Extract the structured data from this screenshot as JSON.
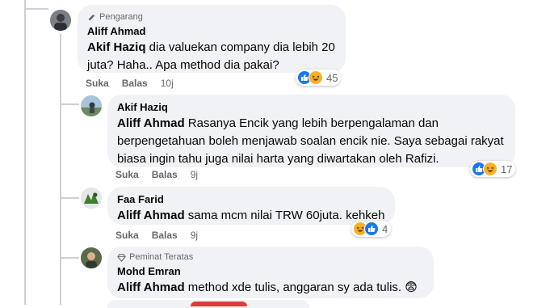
{
  "comments": [
    {
      "badge": "Pengarang",
      "author": "Aliff Ahmad",
      "tag": "Akif Haziq",
      "text": " dia valuekan company dia lebih 20 juta? Haha.. Apa method dia pakai?",
      "actions": {
        "like": "Suka",
        "reply": "Balas",
        "time": "10j"
      },
      "reactions": {
        "count": "45",
        "icons": [
          "like-icon",
          "haha-icon"
        ]
      }
    },
    {
      "author": "Akif Haziq",
      "tag": "Aliff Ahmad",
      "text": " Rasanya Encik yang lebih berpengalaman dan berpengetahuan boleh menjawab soalan encik nie. Saya sebagai rakyat biasa ingin tahu juga nilai harta yang diwartakan oleh Rafizi.",
      "actions": {
        "like": "Suka",
        "reply": "Balas",
        "time": "9j"
      },
      "reactions": {
        "count": "17",
        "icons": [
          "like-icon",
          "haha-icon"
        ]
      }
    },
    {
      "author": "Faa Farid",
      "tag": "Aliff Ahmad",
      "text": " sama mcm nilai TRW 60juta. kehkeh",
      "actions": {
        "like": "Suka",
        "reply": "Balas",
        "time": "9j"
      },
      "reactions": {
        "count": "4",
        "icons": [
          "haha-icon",
          "like-icon"
        ]
      }
    },
    {
      "badge": "Peminat Teratas",
      "author": "Mohd Emran",
      "tag": "Aliff Ahmad",
      "text": " method xde tulis, anggaran sy ada tulis. ",
      "emoji": "😨"
    }
  ],
  "colors": {
    "bubble": "#f0f2f5",
    "meta": "#65676b",
    "like": "#1877f2",
    "haha": "#f7b125",
    "thread": "#ced0d4"
  }
}
